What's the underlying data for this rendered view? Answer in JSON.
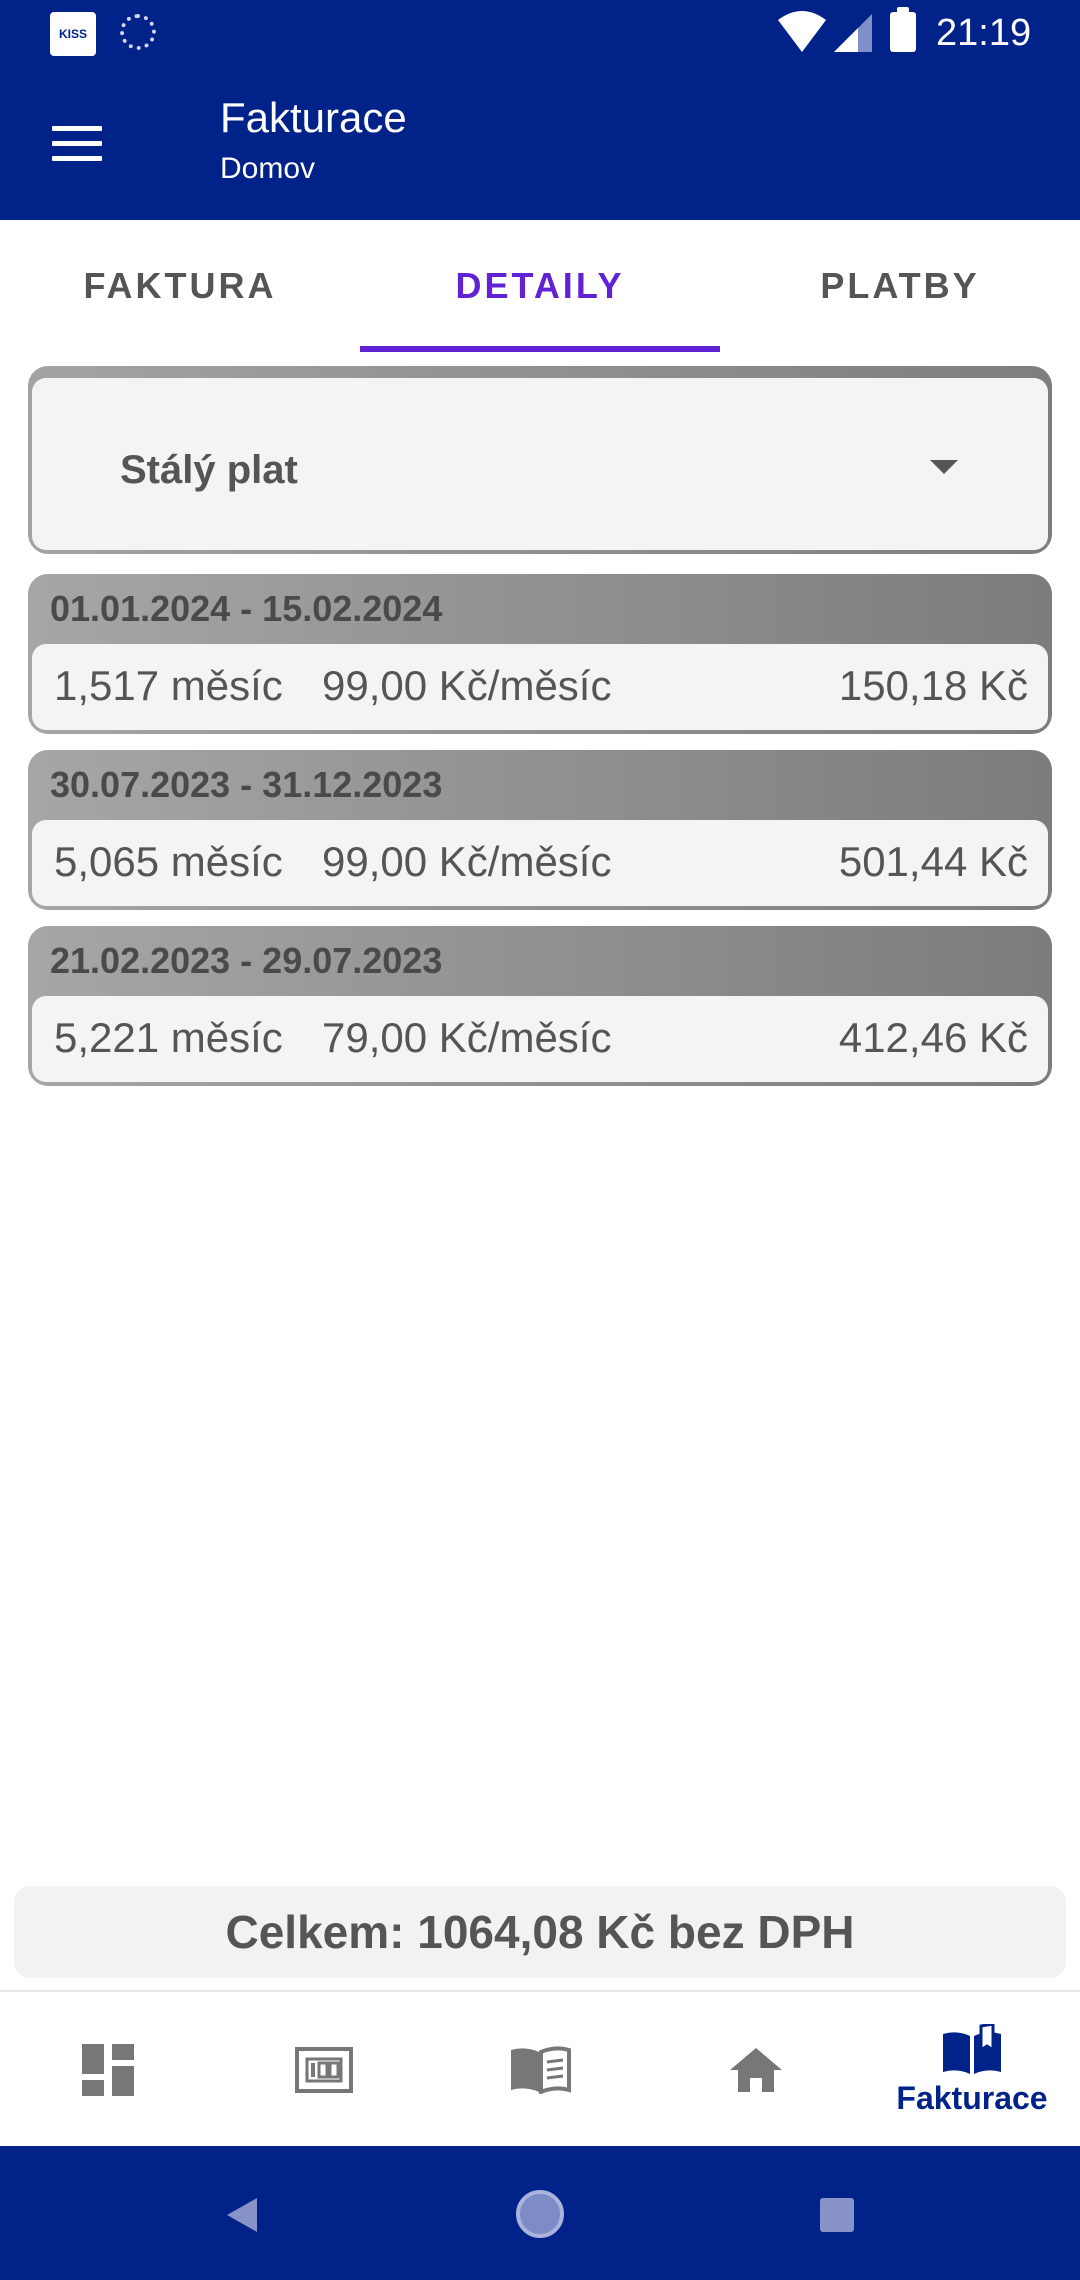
{
  "status_bar": {
    "time": "21:19",
    "app_icon_text": "KISS",
    "icons": [
      "kiss-app-icon",
      "sync-icon",
      "wifi-icon",
      "signal-icon",
      "battery-icon"
    ]
  },
  "app_bar": {
    "title": "Fakturace",
    "subtitle": "Domov",
    "menu_icon": "hamburger-menu-icon"
  },
  "tabs": [
    {
      "label": "FAKTURA",
      "active": false
    },
    {
      "label": "DETAILY",
      "active": true
    },
    {
      "label": "PLATBY",
      "active": false
    }
  ],
  "dropdown": {
    "selected": "Stálý plat",
    "icon": "caret-down-icon"
  },
  "periods": [
    {
      "range": "01.01.2024 - 15.02.2024",
      "months": "1,517 měsíc",
      "rate": "99,00 Kč/měsíc",
      "amount": "150,18 Kč"
    },
    {
      "range": "30.07.2023 - 31.12.2023",
      "months": "5,065 měsíc",
      "rate": "99,00 Kč/měsíc",
      "amount": "501,44 Kč"
    },
    {
      "range": "21.02.2023 - 29.07.2023",
      "months": "5,221 měsíc",
      "rate": "79,00 Kč/měsíc",
      "amount": "412,46 Kč"
    }
  ],
  "total": "Celkem: 1064,08 Kč bez DPH",
  "bottom_nav": [
    {
      "icon": "dashboard-icon",
      "label": "",
      "active": false
    },
    {
      "icon": "meter-icon",
      "label": "",
      "active": false
    },
    {
      "icon": "book-list-icon",
      "label": "",
      "active": false
    },
    {
      "icon": "home-icon",
      "label": "",
      "active": false
    },
    {
      "icon": "open-book-icon",
      "label": "Fakturace",
      "active": true
    }
  ],
  "colors": {
    "primary": "#012288",
    "accent": "#6122d6",
    "inactive_icon": "#777777",
    "text_gray": "#555555"
  }
}
